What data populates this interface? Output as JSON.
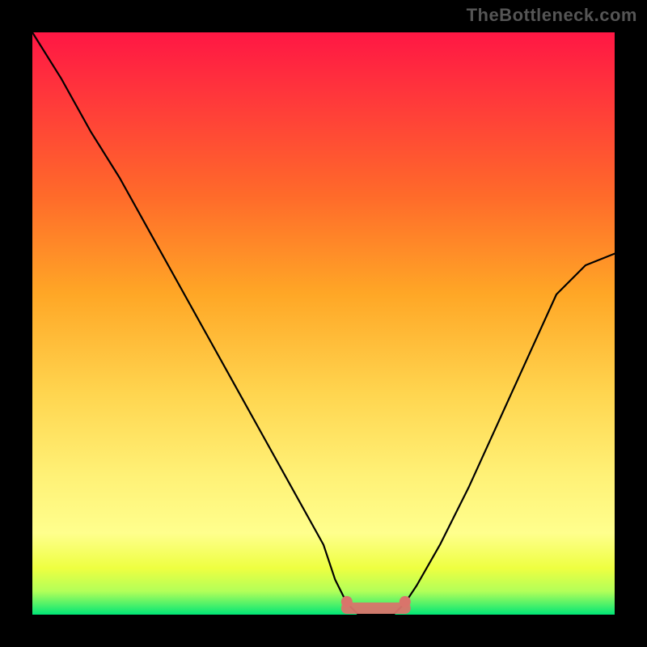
{
  "watermark": "TheBottleneck.com",
  "chart_data": {
    "type": "line",
    "title": "",
    "xlabel": "",
    "ylabel": "",
    "xlim": [
      0,
      100
    ],
    "ylim": [
      0,
      100
    ],
    "series": [
      {
        "name": "bottleneck-curve",
        "x": [
          0,
          5,
          10,
          15,
          20,
          25,
          30,
          35,
          40,
          45,
          50,
          52,
          54,
          56,
          58,
          60,
          62,
          64,
          66,
          70,
          75,
          80,
          85,
          90,
          95,
          100
        ],
        "y": [
          100,
          92,
          83,
          75,
          66,
          57,
          48,
          39,
          30,
          21,
          12,
          6,
          2,
          0,
          0,
          0,
          0,
          2,
          5,
          12,
          22,
          33,
          44,
          55,
          60,
          62
        ]
      },
      {
        "name": "optimal-flat-region",
        "x": [
          54,
          56,
          58,
          60,
          62,
          64
        ],
        "y": [
          0,
          0,
          0,
          0,
          0,
          0
        ]
      }
    ],
    "gradient_stops": [
      {
        "pos": 0,
        "color": "#ff1744"
      },
      {
        "pos": 12,
        "color": "#ff3a3a"
      },
      {
        "pos": 28,
        "color": "#ff6a2a"
      },
      {
        "pos": 45,
        "color": "#ffa726"
      },
      {
        "pos": 62,
        "color": "#ffd54f"
      },
      {
        "pos": 76,
        "color": "#fff176"
      },
      {
        "pos": 86,
        "color": "#ffff8d"
      },
      {
        "pos": 92,
        "color": "#eeff41"
      },
      {
        "pos": 96,
        "color": "#b2ff59"
      },
      {
        "pos": 100,
        "color": "#00e676"
      }
    ],
    "annotations": []
  }
}
